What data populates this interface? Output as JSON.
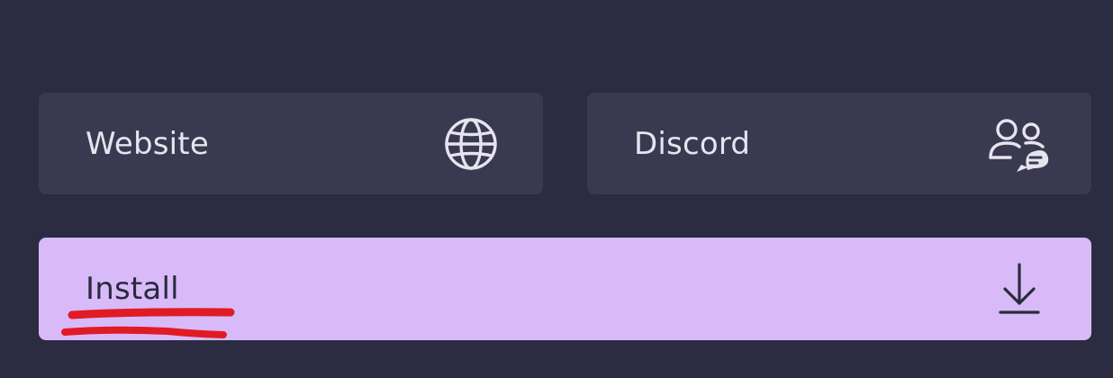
{
  "buttons": {
    "website": {
      "label": "Website",
      "icon": "globe-icon"
    },
    "discord": {
      "label": "Discord",
      "icon": "community-chat-icon"
    },
    "install": {
      "label": "Install",
      "icon": "download-icon"
    }
  },
  "colors": {
    "background": "#2b2c42",
    "secondary_button": "#393950",
    "secondary_text": "#e7e3ef",
    "primary_button": "#d8baf8",
    "primary_text": "#2a2b3e",
    "annotation_underline": "#e11b24"
  },
  "annotation": {
    "type": "red-double-underline",
    "target": "install-label"
  }
}
